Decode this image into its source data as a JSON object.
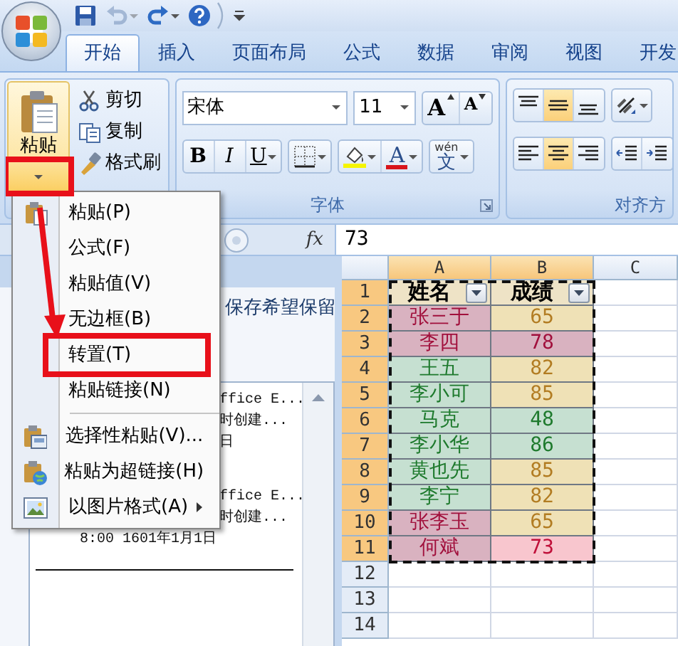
{
  "quick_access": [
    {
      "kind": "save",
      "disabled": false,
      "dropdown": false
    },
    {
      "kind": "undo",
      "disabled": true,
      "dropdown": true
    },
    {
      "kind": "redo",
      "disabled": false,
      "dropdown": true
    },
    {
      "kind": "help",
      "disabled": false,
      "dropdown": false
    }
  ],
  "tabs": [
    {
      "label": "开始",
      "selected": true
    },
    {
      "label": "插入",
      "selected": false
    },
    {
      "label": "页面布局",
      "selected": false
    },
    {
      "label": "公式",
      "selected": false
    },
    {
      "label": "数据",
      "selected": false
    },
    {
      "label": "审阅",
      "selected": false
    },
    {
      "label": "视图",
      "selected": false
    },
    {
      "label": "开发",
      "selected": false
    }
  ],
  "clipboard": {
    "paste": {
      "label": "粘贴",
      "highlighted": true
    },
    "commands": [
      {
        "kind": "cut",
        "label": "剪切"
      },
      {
        "kind": "copy",
        "label": "复制"
      },
      {
        "kind": "format-painter",
        "label": "格式刷"
      }
    ]
  },
  "font": {
    "name": "宋体",
    "size": "11",
    "size_buttons": [
      {
        "kind": "grow",
        "label": "A"
      },
      {
        "kind": "shrink",
        "label": "A"
      }
    ],
    "format_buttons": [
      {
        "kind": "bold",
        "label": "B",
        "dropdown": false
      },
      {
        "kind": "italic",
        "label": "I",
        "dropdown": false
      },
      {
        "kind": "underline",
        "label": "U",
        "dropdown": true
      },
      {
        "kind": "borders",
        "dropdown": true
      },
      {
        "kind": "fill-color",
        "dropdown": true
      },
      {
        "kind": "font-color",
        "label": "A",
        "dropdown": true
      },
      {
        "kind": "phonetic",
        "label": "文",
        "ruby": "wén",
        "dropdown": true
      }
    ],
    "group_label": "字体"
  },
  "alignment": {
    "top_row": [
      {
        "kind": "align-top",
        "on": false,
        "dropdown": false
      },
      {
        "kind": "align-middle",
        "on": true,
        "dropdown": false
      },
      {
        "kind": "align-bottom",
        "on": false,
        "dropdown": false
      },
      {
        "kind": "orientation",
        "on": false,
        "dropdown": true
      }
    ],
    "bottom_row": [
      {
        "kind": "align-left",
        "on": false,
        "dropdown": false
      },
      {
        "kind": "align-center",
        "on": true,
        "dropdown": false
      },
      {
        "kind": "align-right",
        "on": false,
        "dropdown": false
      },
      {
        "kind": "outdent",
        "on": false,
        "dropdown": false
      },
      {
        "kind": "indent",
        "on": false,
        "dropdown": false
      }
    ],
    "group_label": "对齐方"
  },
  "formula_bar": {
    "fx": "fx",
    "value": "73"
  },
  "task_pane": {
    "note": "保存希望保留",
    "entries": [
      {
        "lines": [
          "ffice E...",
          "时创建...",
          "日"
        ]
      },
      {
        "lines": [
          "ffice E...",
          "时创建..."
        ],
        "detail": "8:00 1601年1月1日"
      }
    ]
  },
  "paste_menu": [
    {
      "kind": "paste",
      "label": "粘贴(P)",
      "submenu": false,
      "highlighted": false
    },
    {
      "kind": "plain",
      "label": "公式(F)",
      "submenu": false,
      "highlighted": false
    },
    {
      "kind": "plain",
      "label": "粘贴值(V)",
      "submenu": false,
      "highlighted": false
    },
    {
      "kind": "plain",
      "label": "无边框(B)",
      "submenu": false,
      "highlighted": false
    },
    {
      "kind": "plain",
      "label": "转置(T)",
      "submenu": false,
      "highlighted": true
    },
    {
      "kind": "plain",
      "label": "粘贴链接(N)",
      "submenu": false,
      "highlighted": false
    },
    {
      "kind": "separator"
    },
    {
      "kind": "paste-special",
      "label": "选择性粘贴(V)...",
      "submenu": false,
      "highlighted": false
    },
    {
      "kind": "hyperlink",
      "label": "粘贴为超链接(H)",
      "submenu": false,
      "highlighted": false
    },
    {
      "kind": "picture",
      "label": "以图片格式(A)",
      "submenu": true,
      "highlighted": false
    }
  ],
  "sheet": {
    "columns": [
      {
        "label": "A",
        "selected": true
      },
      {
        "label": "B",
        "selected": true
      },
      {
        "label": "C",
        "selected": false
      }
    ],
    "rows": [
      {
        "label": "1",
        "selected": true,
        "cells": [
          {
            "text": "姓名",
            "kind": "header",
            "filter": true,
            "active": false
          },
          {
            "text": "成绩",
            "kind": "header",
            "filter": true,
            "active": false
          }
        ]
      },
      {
        "label": "2",
        "selected": true,
        "cells": [
          {
            "text": "张三于",
            "kind": "bad",
            "filter": false,
            "active": false
          },
          {
            "text": "65",
            "kind": "neutral",
            "filter": false,
            "active": false
          }
        ]
      },
      {
        "label": "3",
        "selected": true,
        "cells": [
          {
            "text": "李四",
            "kind": "bad",
            "filter": false,
            "active": false
          },
          {
            "text": "78",
            "kind": "bad",
            "filter": false,
            "active": false
          }
        ]
      },
      {
        "label": "4",
        "selected": true,
        "cells": [
          {
            "text": "王五",
            "kind": "good",
            "filter": false,
            "active": false
          },
          {
            "text": "82",
            "kind": "neutral",
            "filter": false,
            "active": false
          }
        ]
      },
      {
        "label": "5",
        "selected": true,
        "cells": [
          {
            "text": "李小可",
            "kind": "good",
            "filter": false,
            "active": false
          },
          {
            "text": "85",
            "kind": "neutral",
            "filter": false,
            "active": false
          }
        ]
      },
      {
        "label": "6",
        "selected": true,
        "cells": [
          {
            "text": "马克",
            "kind": "good",
            "filter": false,
            "active": false
          },
          {
            "text": "48",
            "kind": "good",
            "filter": false,
            "active": false
          }
        ]
      },
      {
        "label": "7",
        "selected": true,
        "cells": [
          {
            "text": "李小华",
            "kind": "good",
            "filter": false,
            "active": false
          },
          {
            "text": "86",
            "kind": "good",
            "filter": false,
            "active": false
          }
        ]
      },
      {
        "label": "8",
        "selected": true,
        "cells": [
          {
            "text": "黄也先",
            "kind": "good",
            "filter": false,
            "active": false
          },
          {
            "text": "85",
            "kind": "neutral",
            "filter": false,
            "active": false
          }
        ]
      },
      {
        "label": "9",
        "selected": true,
        "cells": [
          {
            "text": "李宁",
            "kind": "good",
            "filter": false,
            "active": false
          },
          {
            "text": "82",
            "kind": "neutral",
            "filter": false,
            "active": false
          }
        ]
      },
      {
        "label": "10",
        "selected": true,
        "cells": [
          {
            "text": "张李玉",
            "kind": "bad",
            "filter": false,
            "active": false
          },
          {
            "text": "65",
            "kind": "neutral",
            "filter": false,
            "active": false
          }
        ]
      },
      {
        "label": "11",
        "selected": true,
        "cells": [
          {
            "text": "何斌",
            "kind": "bad",
            "filter": false,
            "active": false
          },
          {
            "text": "73",
            "kind": "bad",
            "filter": false,
            "active": true
          }
        ]
      },
      {
        "label": "12",
        "selected": false
      },
      {
        "label": "13",
        "selected": false
      },
      {
        "label": "14",
        "selected": false
      }
    ]
  }
}
